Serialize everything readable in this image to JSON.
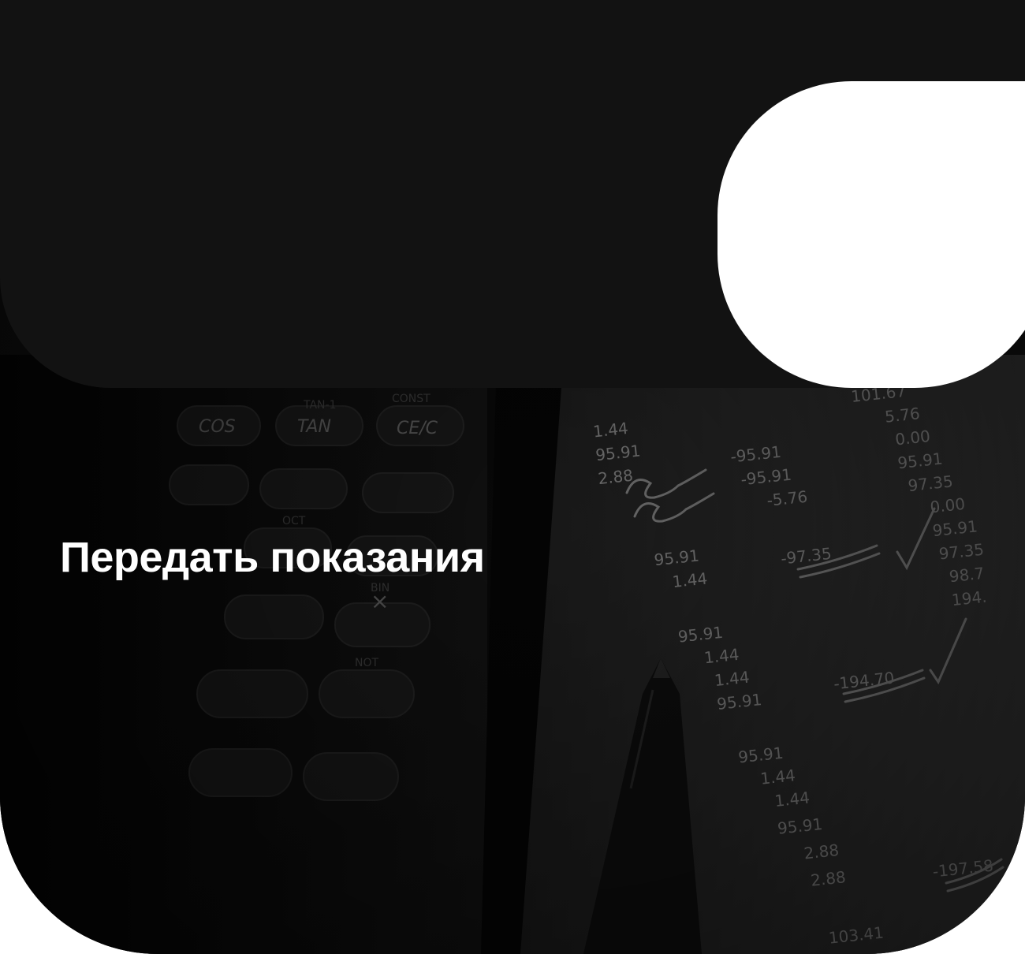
{
  "card": {
    "title": "Передать показания",
    "background_image": "calculator-and-receipt-photo"
  },
  "colors": {
    "card_background": "#121212",
    "title_text": "#ffffff",
    "cutout": "#ffffff"
  }
}
